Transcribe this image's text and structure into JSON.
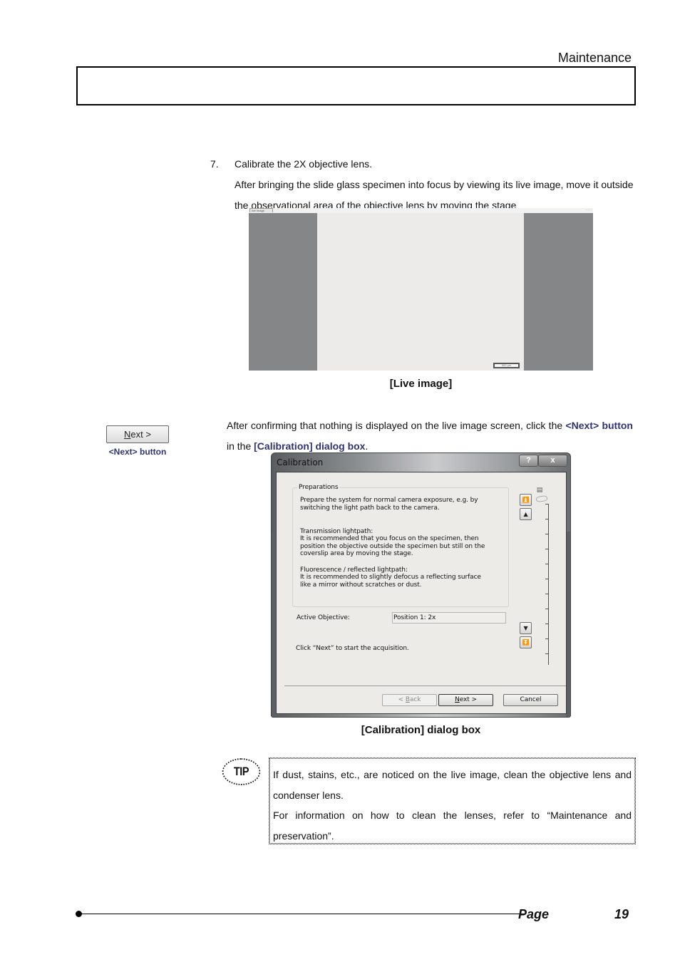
{
  "header": {
    "section_title": "Maintenance"
  },
  "step": {
    "number": "7.",
    "title": "Calibrate the 2X objective lens.",
    "instruction": "After bringing the slide glass specimen into focus by viewing its live image, move it outside the observational area of the objective lens by moving the stage"
  },
  "live_image": {
    "tab_label": "live image",
    "window_controls": "◦ ◦ ◦",
    "scale_bar_label": "500 µm",
    "caption": "[Live image]"
  },
  "side_button": {
    "label_prefix": "N",
    "label_rest": "ext >",
    "caption": "<Next> button"
  },
  "paragraph2": {
    "part1": "After confirming that nothing is displayed on the live image screen, click the ",
    "hl1": "<Next> button",
    "part2": " in the ",
    "hl2": "[Calibration] dialog box",
    "part3": "."
  },
  "dialog": {
    "title": "Calibration",
    "help_label": "?",
    "close_label": "x",
    "group_label": "Preparations",
    "prep_text": "Prepare the system for normal camera exposure, e.g. by\nswitching the light path back to the camera.",
    "trans_heading": "Transmission lightpath:",
    "trans_text": "It is recommended that you focus on the specimen, then\nposition the objective outside the specimen but still on the\ncoverslip area by moving the stage.",
    "fluo_heading": "Fluorescence / reflected lightpath:",
    "fluo_text": "It is recommended to slightly defocus a reflecting surface\nlike a mirror without scratches or dust.",
    "active_objective_label": "Active Objective:",
    "active_objective_value": "Position 1: 2x",
    "click_instruction": "Click “Next” to start the acquisition.",
    "buttons": {
      "back_prefix": "< ",
      "back_key": "B",
      "back_rest": "ack",
      "next_key": "N",
      "next_rest": "ext >",
      "cancel": "Cancel"
    },
    "z_controls": {
      "top": "⏫",
      "up": "▲",
      "down": "▼",
      "bottom": "⏬"
    },
    "caption": "[Calibration] dialog box"
  },
  "tip": {
    "badge": "TIP",
    "line1": "If dust, stains, etc., are noticed on the live image, clean the objective lens and condenser lens.",
    "line2": "For information on how to clean the lenses, refer to “Maintenance and preservation”."
  },
  "footer": {
    "page_label": "Page",
    "page_number": "19"
  }
}
